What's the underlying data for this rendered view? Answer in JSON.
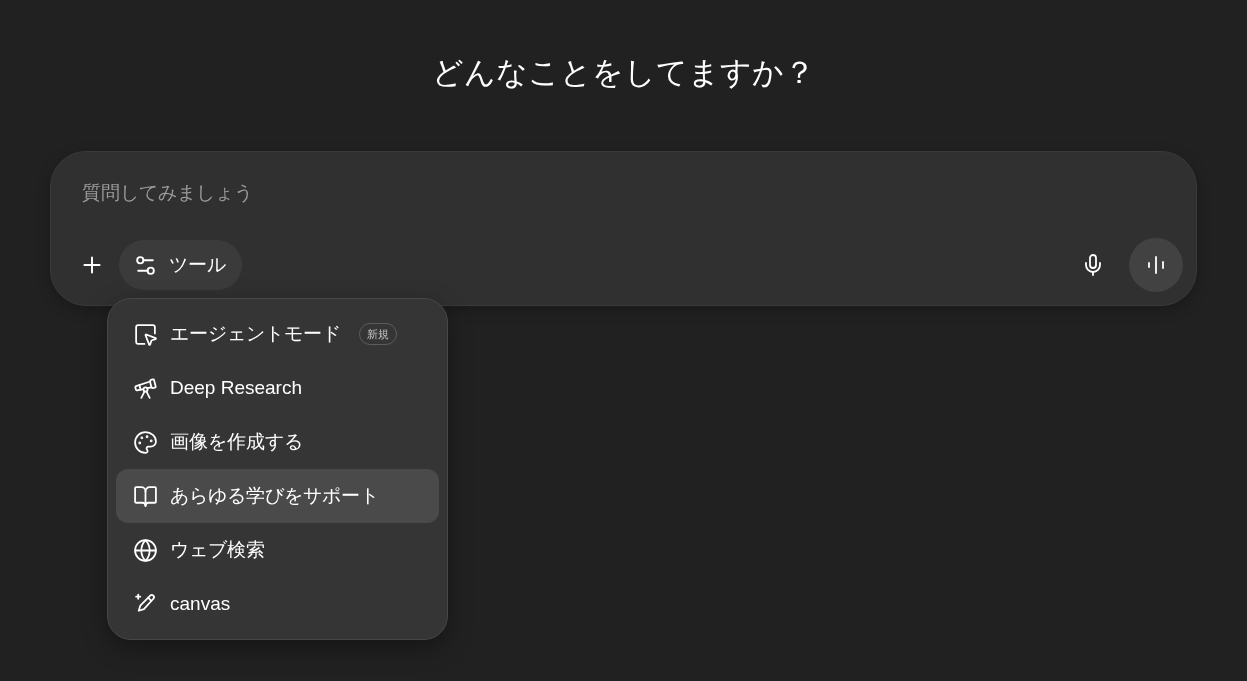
{
  "heading": "どんなことをしてますか？",
  "composer": {
    "placeholder": "質問してみましょう",
    "tools_button": {
      "label": "ツール"
    }
  },
  "tools_menu": {
    "items": [
      {
        "label": "エージェントモード",
        "badge": "新規",
        "selected": false
      },
      {
        "label": "Deep Research",
        "selected": false
      },
      {
        "label": "画像を作成する",
        "selected": false
      },
      {
        "label": "あらゆる学びをサポート",
        "selected": true
      },
      {
        "label": "ウェブ検索",
        "selected": false
      },
      {
        "label": "canvas",
        "selected": false
      }
    ]
  }
}
